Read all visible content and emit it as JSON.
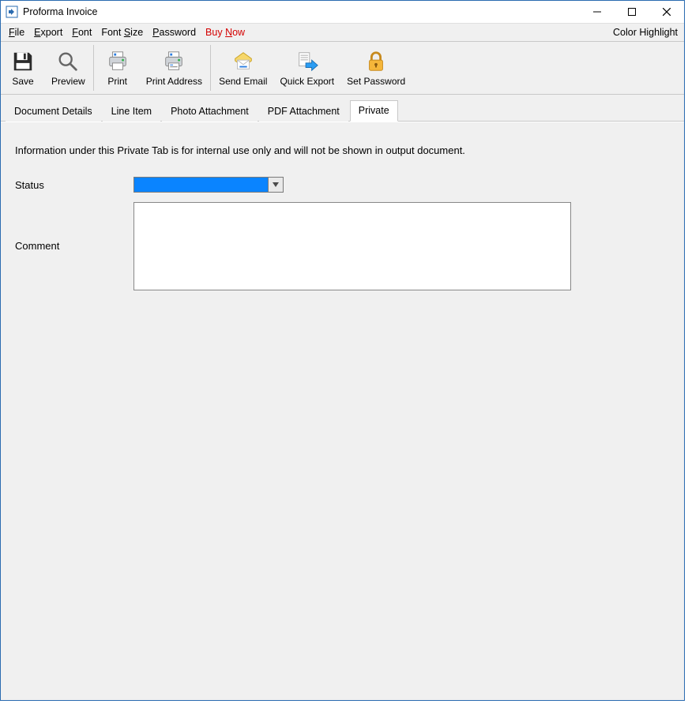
{
  "window": {
    "title": "Proforma Invoice"
  },
  "menu": {
    "file": "File",
    "export": "Export",
    "font": "Font",
    "font_size": "Font Size",
    "password": "Password",
    "buy_now": "Buy Now",
    "color_highlight": "Color Highlight"
  },
  "toolbar": {
    "save": "Save",
    "preview": "Preview",
    "print": "Print",
    "print_address": "Print Address",
    "send_email": "Send Email",
    "quick_export": "Quick Export",
    "set_password": "Set Password"
  },
  "tabs": {
    "document_details": "Document Details",
    "line_item": "Line Item",
    "photo_attachment": "Photo Attachment",
    "pdf_attachment": "PDF Attachment",
    "private": "Private"
  },
  "private_tab": {
    "info_text": "Information under this Private Tab is for internal use only and will not be shown in output document.",
    "status_label": "Status",
    "status_value": "",
    "comment_label": "Comment",
    "comment_value": ""
  }
}
